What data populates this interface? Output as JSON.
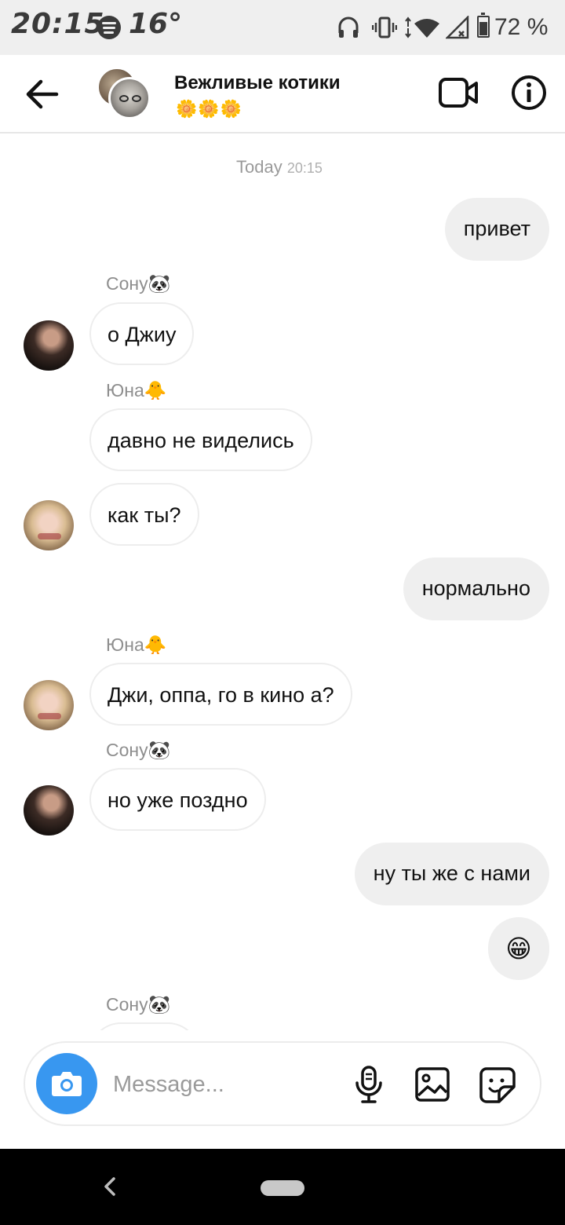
{
  "status_bar": {
    "time": "20:15",
    "temperature": "16°",
    "battery_percent": "72 %",
    "battery_level": 0.72,
    "icons": [
      "spotify-icon",
      "headphones-icon",
      "vibrate-icon",
      "wifi-icon",
      "signal-icon",
      "battery-icon"
    ]
  },
  "header": {
    "title": "Вежливые котики",
    "subtitle": "🌼🌼🌼",
    "icons": [
      "back-arrow-icon",
      "video-camera-icon",
      "info-icon"
    ]
  },
  "conversation": {
    "date_label": "Today",
    "date_time": "20:15",
    "messages": [
      {
        "id": "m1",
        "direction": "out",
        "text": "привет"
      },
      {
        "id": "m2",
        "direction": "in",
        "sender": "Сону🐼",
        "text": "о Джиу",
        "avatar": "sonu"
      },
      {
        "id": "m3",
        "direction": "in",
        "sender": "Юна🐥",
        "text": "давно не виделись"
      },
      {
        "id": "m4",
        "direction": "in",
        "text": "как ты?",
        "avatar": "yuna"
      },
      {
        "id": "m5",
        "direction": "out",
        "text": "нормально"
      },
      {
        "id": "m6",
        "direction": "in",
        "sender": "Юна🐥",
        "text": "Джи, оппа, го в кино а?",
        "avatar": "yuna"
      },
      {
        "id": "m7",
        "direction": "in",
        "sender": "Сону🐼",
        "text": "но уже поздно",
        "avatar": "sonu"
      },
      {
        "id": "m8",
        "direction": "out",
        "text": "ну ты же с нами"
      },
      {
        "id": "m9",
        "direction": "out",
        "text": "😁"
      },
      {
        "id": "m10",
        "direction": "in",
        "sender": "Сону🐼",
        "text": ""
      }
    ]
  },
  "composer": {
    "placeholder": "Message...",
    "icons": [
      "camera-icon",
      "microphone-icon",
      "gallery-icon",
      "sticker-icon"
    ]
  },
  "colors": {
    "accent": "#3897f0",
    "outgoing_bubble": "#efefef",
    "incoming_border": "#ededed",
    "meta_text": "#8e8e8e"
  }
}
